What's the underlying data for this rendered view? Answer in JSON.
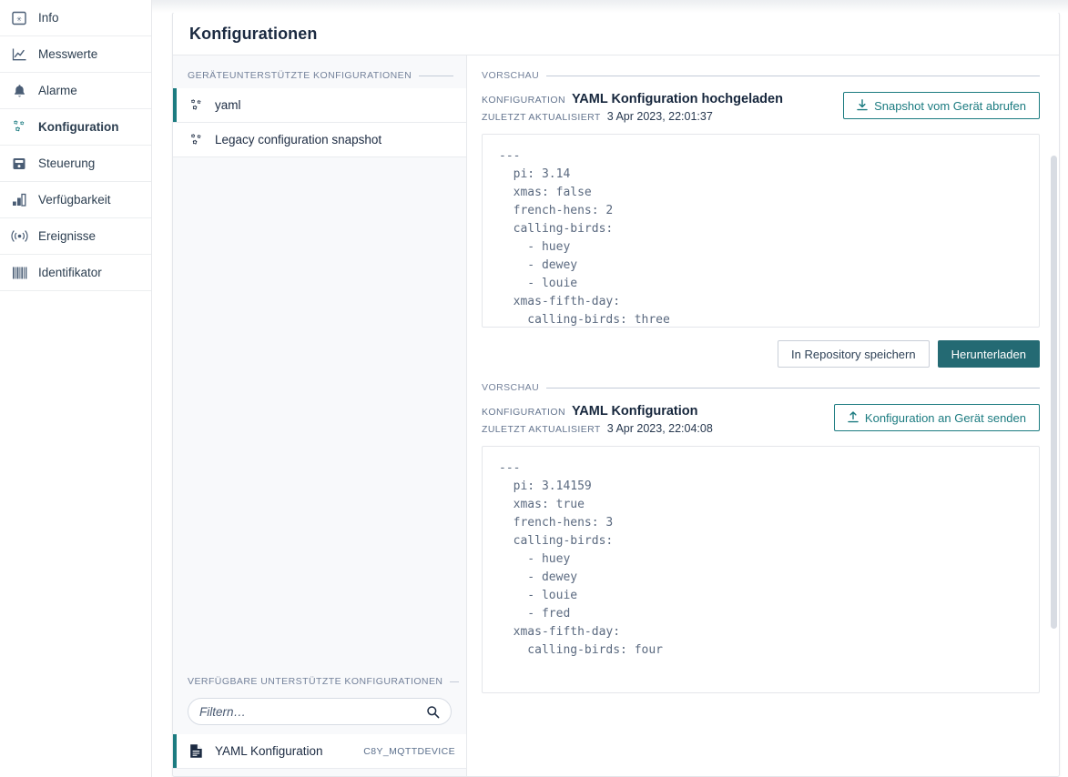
{
  "sidebar": {
    "items": [
      {
        "label": "Info",
        "icon": "info-badge-icon",
        "active": false
      },
      {
        "label": "Messwerte",
        "icon": "line-chart-icon",
        "active": false
      },
      {
        "label": "Alarme",
        "icon": "bell-icon",
        "active": false
      },
      {
        "label": "Konfiguration",
        "icon": "gears-icon",
        "active": true
      },
      {
        "label": "Steuerung",
        "icon": "device-control-icon",
        "active": false
      },
      {
        "label": "Verfügbarkeit",
        "icon": "bar-chart-icon",
        "active": false
      },
      {
        "label": "Ereignisse",
        "icon": "broadcast-icon",
        "active": false
      },
      {
        "label": "Identifikator",
        "icon": "barcode-icon",
        "active": false
      }
    ]
  },
  "page": {
    "title": "Konfigurationen"
  },
  "device_supported": {
    "legend": "GERÄTEUNTERSTÜTZTE KONFIGURATIONEN",
    "items": [
      {
        "label": "yaml",
        "icon": "gears-icon",
        "selected": true,
        "badge": ""
      },
      {
        "label": "Legacy configuration snapshot",
        "icon": "gears-icon",
        "selected": false,
        "badge": ""
      }
    ]
  },
  "available_supported": {
    "legend": "VERFÜGBARE UNTERSTÜTZTE KONFIGURATIONEN",
    "filter": {
      "placeholder": "Filtern…",
      "value": "",
      "icon": "search-icon"
    },
    "items": [
      {
        "label": "YAML Konfiguration",
        "icon": "file-document-icon",
        "selected": true,
        "badge": "C8Y_MQTTDEVICE"
      }
    ]
  },
  "preview_top": {
    "legend": "VORSCHAU",
    "config_key": "KONFIGURATION",
    "config_name": "YAML Konfiguration hochgeladen",
    "updated_key": "ZULETZT AKTUALISIERT",
    "updated_value": "3 Apr 2023, 22:01:37",
    "header_button": {
      "label": "Snapshot vom Gerät abrufen",
      "icon": "download-icon"
    },
    "code": "---\n  pi: 3.14\n  xmas: false\n  french-hens: 2\n  calling-birds:\n    - huey\n    - dewey\n    - louie\n  xmas-fifth-day:\n    calling-birds: three",
    "actions": [
      {
        "label": "In Repository speichern",
        "style": "outline-light"
      },
      {
        "label": "Herunterladen",
        "style": "primary"
      }
    ]
  },
  "preview_bottom": {
    "legend": "VORSCHAU",
    "config_key": "KONFIGURATION",
    "config_name": "YAML Konfiguration",
    "updated_key": "ZULETZT AKTUALISIERT",
    "updated_value": "3 Apr 2023, 22:04:08",
    "header_button": {
      "label": "Konfiguration an Gerät senden",
      "icon": "upload-icon"
    },
    "code": "---\n  pi: 3.14159\n  xmas: true\n  french-hens: 3\n  calling-birds:\n    - huey\n    - dewey\n    - louie\n    - fred\n  xmas-fifth-day:\n    calling-birds: four"
  },
  "colors": {
    "accent": "#1b7b80",
    "primary_button": "#246a73",
    "text_dark": "#16263c",
    "muted": "#73819a",
    "panel_bg": "#f8f9fb"
  }
}
